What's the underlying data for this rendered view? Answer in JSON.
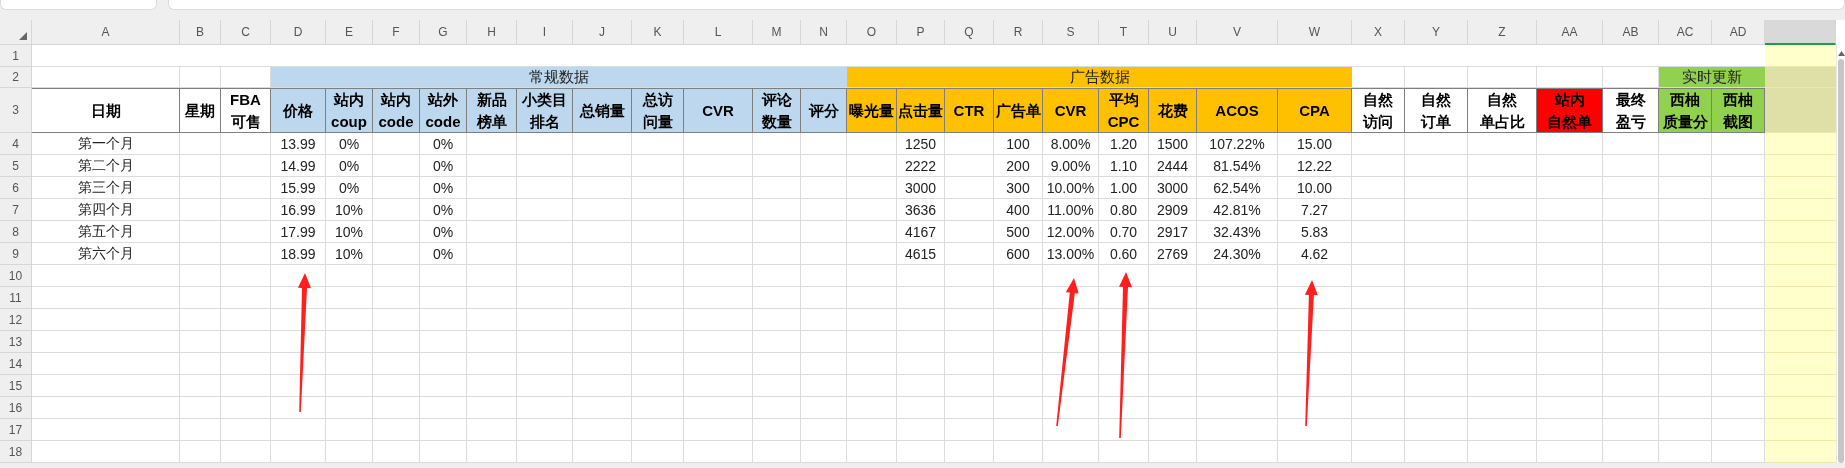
{
  "column_letters": [
    "A",
    "B",
    "C",
    "D",
    "E",
    "F",
    "G",
    "H",
    "I",
    "J",
    "K",
    "L",
    "M",
    "N",
    "O",
    "P",
    "Q",
    "R",
    "S",
    "T",
    "U",
    "V",
    "W",
    "X",
    "Y",
    "Z",
    "AA",
    "AB",
    "AC",
    "AD"
  ],
  "header_row_numbers": [
    "1",
    "2",
    "3"
  ],
  "header_groups": [
    {
      "columns": [
        {
          "lines": [
            "日期"
          ],
          "color": "#ffffff"
        },
        {
          "lines": [
            "星期"
          ],
          "color": "#ffffff"
        },
        {
          "lines": [
            "FBA",
            "可售"
          ],
          "color": "#ffffff"
        }
      ]
    },
    {
      "title": "常规数据",
      "color": "#bdd7ee",
      "columns": [
        {
          "lines": [
            "价格"
          ],
          "color": "#bdd7ee"
        },
        {
          "lines": [
            "站内",
            "coup"
          ],
          "color": "#bdd7ee"
        },
        {
          "lines": [
            "站内",
            "code"
          ],
          "color": "#bdd7ee"
        },
        {
          "lines": [
            "站外",
            "code"
          ],
          "color": "#bdd7ee"
        },
        {
          "lines": [
            "新品",
            "榜单"
          ],
          "color": "#bdd7ee"
        },
        {
          "lines": [
            "小类目",
            "排名"
          ],
          "color": "#bdd7ee"
        },
        {
          "lines": [
            "总销量"
          ],
          "color": "#bdd7ee"
        },
        {
          "lines": [
            "总访",
            "问量"
          ],
          "color": "#bdd7ee"
        },
        {
          "lines": [
            "CVR"
          ],
          "color": "#bdd7ee"
        },
        {
          "lines": [
            "评论",
            "数量"
          ],
          "color": "#bdd7ee"
        },
        {
          "lines": [
            "评分"
          ],
          "color": "#bdd7ee"
        }
      ]
    },
    {
      "title": "广告数据",
      "color": "#ffc000",
      "columns": [
        {
          "lines": [
            "曝光量"
          ],
          "color": "#ffc000"
        },
        {
          "lines": [
            "点击量"
          ],
          "color": "#ffc000"
        },
        {
          "lines": [
            "CTR"
          ],
          "color": "#ffc000"
        },
        {
          "lines": [
            "广告单"
          ],
          "color": "#ffc000"
        },
        {
          "lines": [
            "CVR"
          ],
          "color": "#ffc000"
        },
        {
          "lines": [
            "平均",
            "CPC"
          ],
          "color": "#ffc000"
        },
        {
          "lines": [
            "花费"
          ],
          "color": "#ffc000"
        },
        {
          "lines": [
            "ACOS"
          ],
          "color": "#ffc000"
        },
        {
          "lines": [
            "CPA"
          ],
          "color": "#ffc000"
        }
      ]
    },
    {
      "columns": [
        {
          "lines": [
            "自然",
            "访问"
          ],
          "color": "#ffffff"
        },
        {
          "lines": [
            "自然",
            "订单"
          ],
          "color": "#ffffff"
        },
        {
          "lines": [
            "自然",
            "单占比"
          ],
          "color": "#ffffff"
        },
        {
          "lines": [
            "站内",
            "自然单"
          ],
          "color": "#ff0000"
        },
        {
          "lines": [
            "最终",
            "盈亏"
          ],
          "color": "#ffffff"
        }
      ]
    },
    {
      "title": "实时更新",
      "color": "#92d050",
      "columns": [
        {
          "lines": [
            "西柚",
            "质量分"
          ],
          "color": "#92d050"
        },
        {
          "lines": [
            "西柚",
            "截图"
          ],
          "color": "#92d050"
        }
      ]
    }
  ],
  "rows": [
    {
      "number": "4",
      "cells": {
        "A": "第一个月",
        "D": "13.99",
        "E": "0%",
        "G": "0%",
        "P": "1250",
        "R": "100",
        "S": "8.00%",
        "T": "1.20",
        "U": "1500",
        "V": "107.22%",
        "W": "15.00"
      }
    },
    {
      "number": "5",
      "cells": {
        "A": "第二个月",
        "D": "14.99",
        "E": "0%",
        "G": "0%",
        "P": "2222",
        "R": "200",
        "S": "9.00%",
        "T": "1.10",
        "U": "2444",
        "V": "81.54%",
        "W": "12.22"
      }
    },
    {
      "number": "6",
      "cells": {
        "A": "第三个月",
        "D": "15.99",
        "E": "0%",
        "G": "0%",
        "P": "3000",
        "R": "300",
        "S": "10.00%",
        "T": "1.00",
        "U": "3000",
        "V": "62.54%",
        "W": "10.00"
      }
    },
    {
      "number": "7",
      "cells": {
        "A": "第四个月",
        "D": "16.99",
        "E": "10%",
        "G": "0%",
        "P": "3636",
        "R": "400",
        "S": "11.00%",
        "T": "0.80",
        "U": "2909",
        "V": "42.81%",
        "W": "7.27"
      }
    },
    {
      "number": "8",
      "cells": {
        "A": "第五个月",
        "D": "17.99",
        "E": "10%",
        "G": "0%",
        "P": "4167",
        "R": "500",
        "S": "12.00%",
        "T": "0.70",
        "U": "2917",
        "V": "32.43%",
        "W": "5.83"
      }
    },
    {
      "number": "9",
      "cells": {
        "A": "第六个月",
        "D": "18.99",
        "E": "10%",
        "G": "0%",
        "P": "4615",
        "R": "600",
        "S": "13.00%",
        "T": "0.60",
        "U": "2769",
        "V": "24.30%",
        "W": "4.62"
      }
    },
    {
      "number": "10"
    },
    {
      "number": "11"
    },
    {
      "number": "12"
    },
    {
      "number": "13"
    },
    {
      "number": "14"
    },
    {
      "number": "15"
    },
    {
      "number": "16"
    },
    {
      "number": "17"
    },
    {
      "number": "18"
    }
  ]
}
